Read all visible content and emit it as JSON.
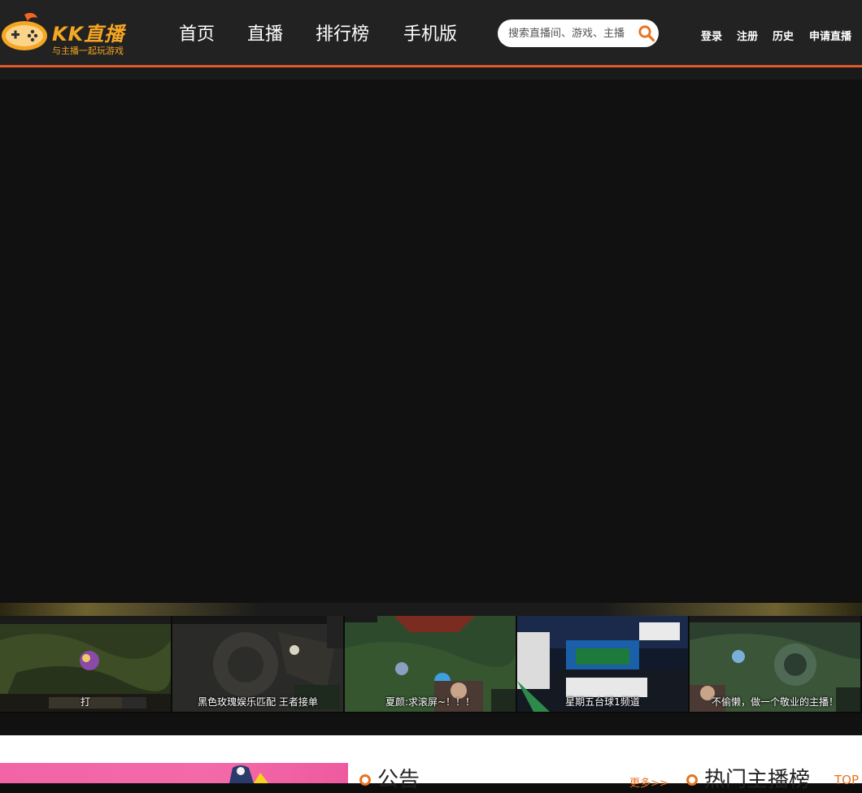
{
  "logo": {
    "brand": "KK直播",
    "slogan": "与主播一起玩游戏"
  },
  "nav": [
    {
      "label": "首页"
    },
    {
      "label": "直播"
    },
    {
      "label": "排行榜"
    },
    {
      "label": "手机版"
    }
  ],
  "search": {
    "placeholder": "搜索直播间、游戏、主播"
  },
  "user_links": [
    {
      "label": "登录"
    },
    {
      "label": "注册"
    },
    {
      "label": "历史"
    },
    {
      "label": "申请直播"
    }
  ],
  "thumbnails": [
    {
      "caption": "打"
    },
    {
      "caption": "黑色玫瑰娱乐匹配 王者接单"
    },
    {
      "caption": "夏颜:求滚屏~！！！"
    },
    {
      "caption": "星期五台球1频道"
    },
    {
      "caption": "不偷懒，做一个敬业的主播！"
    }
  ],
  "announcements": {
    "title": "公告",
    "more": "更多>>"
  },
  "hot_anchors": {
    "title": "热门主播榜",
    "tag": "TOP"
  },
  "colors": {
    "accent": "#e05a2b",
    "brand": "#f5a623",
    "link": "#e8731f"
  }
}
